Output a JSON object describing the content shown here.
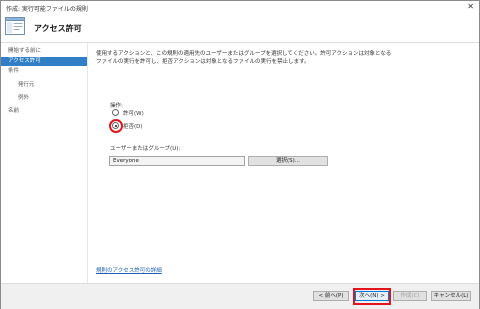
{
  "window": {
    "title": "作成: 実行可能ファイルの規則",
    "close_glyph": "✕"
  },
  "header": {
    "title": "アクセス許可"
  },
  "sidebar": {
    "items": [
      {
        "label": "開始する前に"
      },
      {
        "label": "アクセス許可"
      },
      {
        "label": "条件"
      },
      {
        "label": "発行元"
      },
      {
        "label": "例外"
      },
      {
        "label": "名前"
      }
    ]
  },
  "content": {
    "description": "使用するアクションと、この規則の適用先のユーザーまたはグループを選択してください。許可アクションは対象となるファイルの実行を許可し、拒否アクションは対象となるファイルの実行を禁止します。",
    "action_label": "操作:",
    "allow_label": "許可(W)",
    "deny_label": "拒否(D)",
    "group_label": "ユーザーまたはグループ(U):",
    "group_value": "Everyone",
    "select_button": "選択(S)...",
    "link_text": "規則のアクセス許可の詳細"
  },
  "footer": {
    "back": "< 前へ(P)",
    "next": "次へ(N) >",
    "create": "作成(C)",
    "cancel": "キャンセル(L)"
  },
  "colors": {
    "accent": "#2f7ec6",
    "highlight": "#e2141d"
  }
}
